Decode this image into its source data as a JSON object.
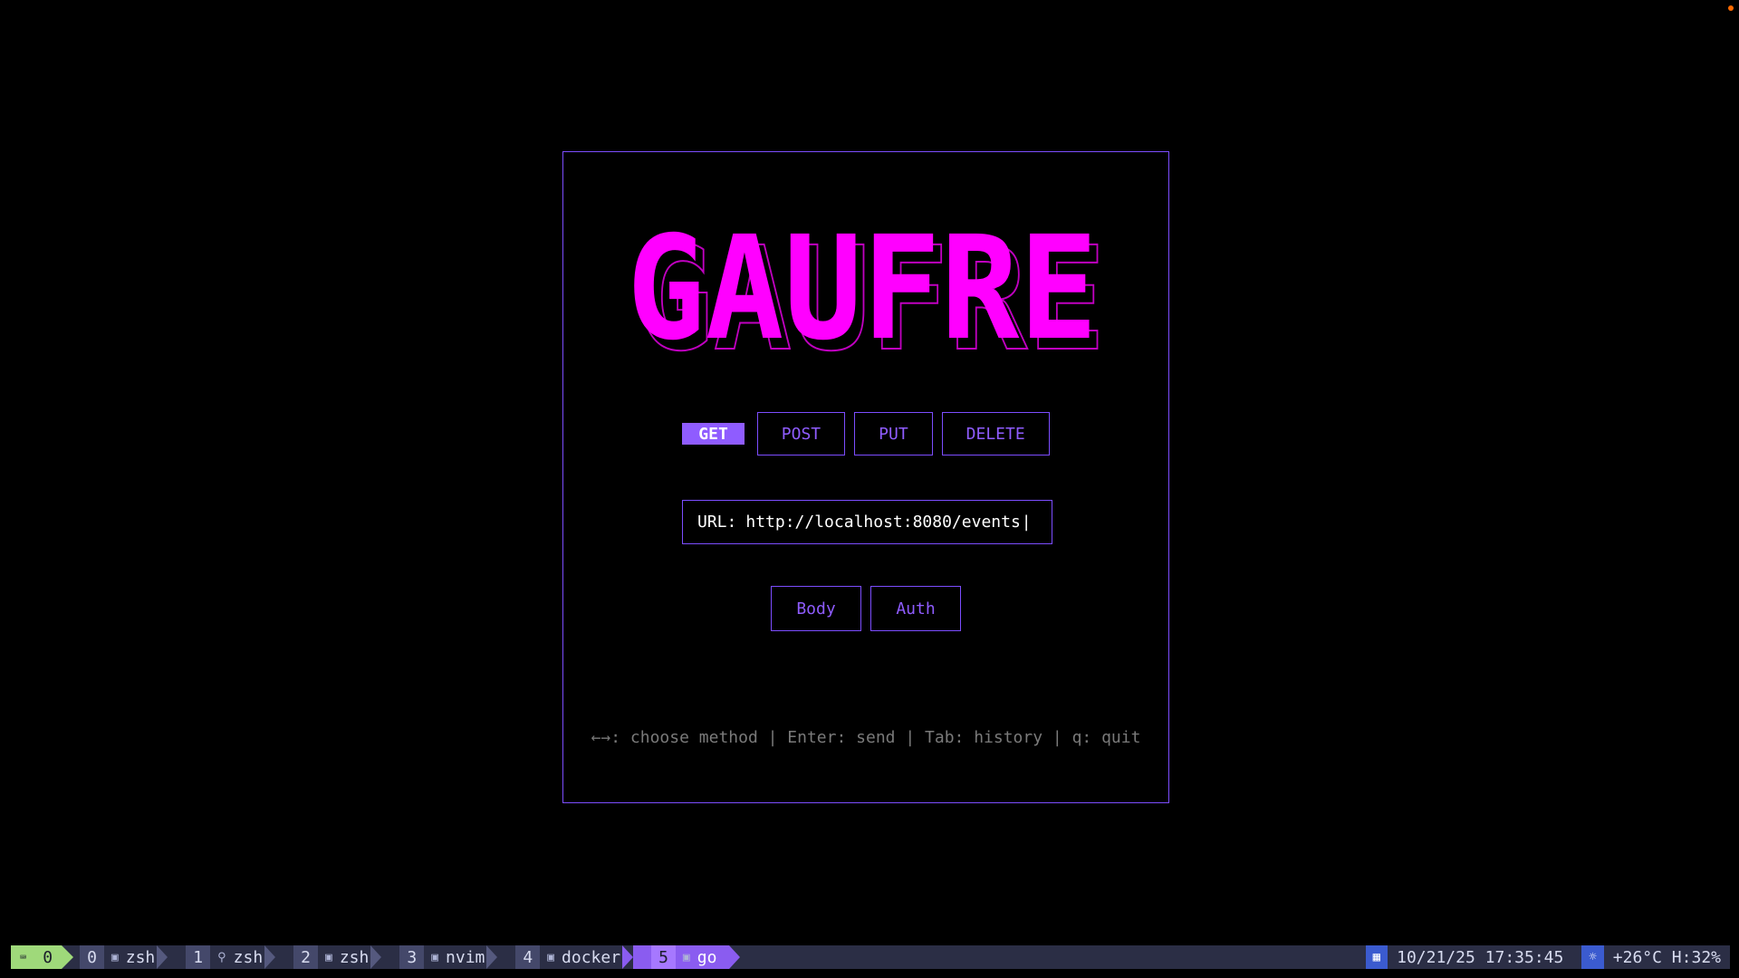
{
  "app": {
    "logo_text": "GAUFRE",
    "logo_color": "#ff00ff"
  },
  "methods": [
    {
      "label": "GET",
      "active": true
    },
    {
      "label": "POST",
      "active": false
    },
    {
      "label": "PUT",
      "active": false
    },
    {
      "label": "DELETE",
      "active": false
    }
  ],
  "url": {
    "label": "URL:",
    "value": "http://localhost:8080/events",
    "cursor": "|"
  },
  "tabs": [
    {
      "label": "Body"
    },
    {
      "label": "Auth"
    }
  ],
  "help_text": "←→: choose method | Enter: send | Tab: history | q: quit",
  "statusbar": {
    "session": "0",
    "windows": [
      {
        "num": "0",
        "icon": "terminal-icon",
        "name": "zsh",
        "current": false
      },
      {
        "num": "1",
        "icon": "search-icon",
        "name": "zsh",
        "current": false
      },
      {
        "num": "2",
        "icon": "terminal-icon",
        "name": "zsh",
        "current": false
      },
      {
        "num": "3",
        "icon": "terminal-icon",
        "name": "nvim",
        "current": false
      },
      {
        "num": "4",
        "icon": "terminal-icon",
        "name": "docker",
        "current": false
      },
      {
        "num": "5",
        "icon": "terminal-icon",
        "name": "go",
        "current": true
      }
    ],
    "datetime": "10/21/25 17:35:45",
    "weather": "+26°C H:32%"
  },
  "colors": {
    "accent": "#7c4dff",
    "accent_text": "#8f5cff",
    "logo": "#ff00ff",
    "help": "#7a7a7a",
    "corner_dot": "#ff6a00"
  }
}
